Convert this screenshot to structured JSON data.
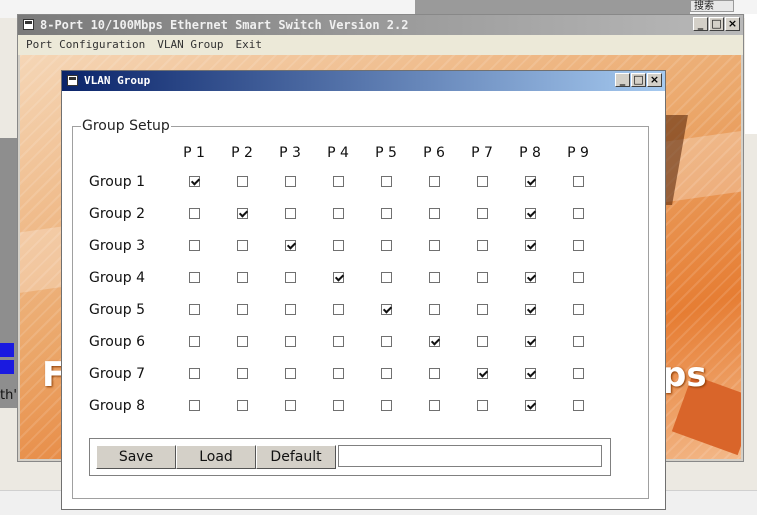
{
  "background": {
    "search_label": "搜索",
    "left_fragment": "th\""
  },
  "main_window": {
    "title": "8-Port 10/100Mbps Ethernet Smart Switch Version 2.2",
    "controls": {
      "minimize": "_",
      "maximize": "□",
      "close": "×"
    },
    "menu": [
      "Port Configuration",
      "VLAN Group",
      "Exit"
    ],
    "splash_text_left": "F",
    "splash_text_right": "ps"
  },
  "dialog": {
    "title": "VLAN Group",
    "controls": {
      "minimize": "_",
      "maximize": "□",
      "close": "×"
    },
    "group_box_label": "Group Setup",
    "ports": [
      "P 1",
      "P 2",
      "P 3",
      "P 4",
      "P 5",
      "P 6",
      "P 7",
      "P 8",
      "P 9"
    ],
    "groups": [
      {
        "label": "Group 1",
        "checked": [
          true,
          false,
          false,
          false,
          false,
          false,
          false,
          true,
          false
        ]
      },
      {
        "label": "Group 2",
        "checked": [
          false,
          true,
          false,
          false,
          false,
          false,
          false,
          true,
          false
        ]
      },
      {
        "label": "Group 3",
        "checked": [
          false,
          false,
          true,
          false,
          false,
          false,
          false,
          true,
          false
        ]
      },
      {
        "label": "Group 4",
        "checked": [
          false,
          false,
          false,
          true,
          false,
          false,
          false,
          true,
          false
        ]
      },
      {
        "label": "Group 5",
        "checked": [
          false,
          false,
          false,
          false,
          true,
          false,
          false,
          true,
          false
        ]
      },
      {
        "label": "Group 6",
        "checked": [
          false,
          false,
          false,
          false,
          false,
          true,
          false,
          true,
          false
        ]
      },
      {
        "label": "Group 7",
        "checked": [
          false,
          false,
          false,
          false,
          false,
          false,
          true,
          true,
          false
        ]
      },
      {
        "label": "Group 8",
        "checked": [
          false,
          false,
          false,
          false,
          false,
          false,
          false,
          true,
          false
        ]
      }
    ],
    "buttons": {
      "save": "Save",
      "load": "Load",
      "default": "Default"
    },
    "status_value": ""
  }
}
